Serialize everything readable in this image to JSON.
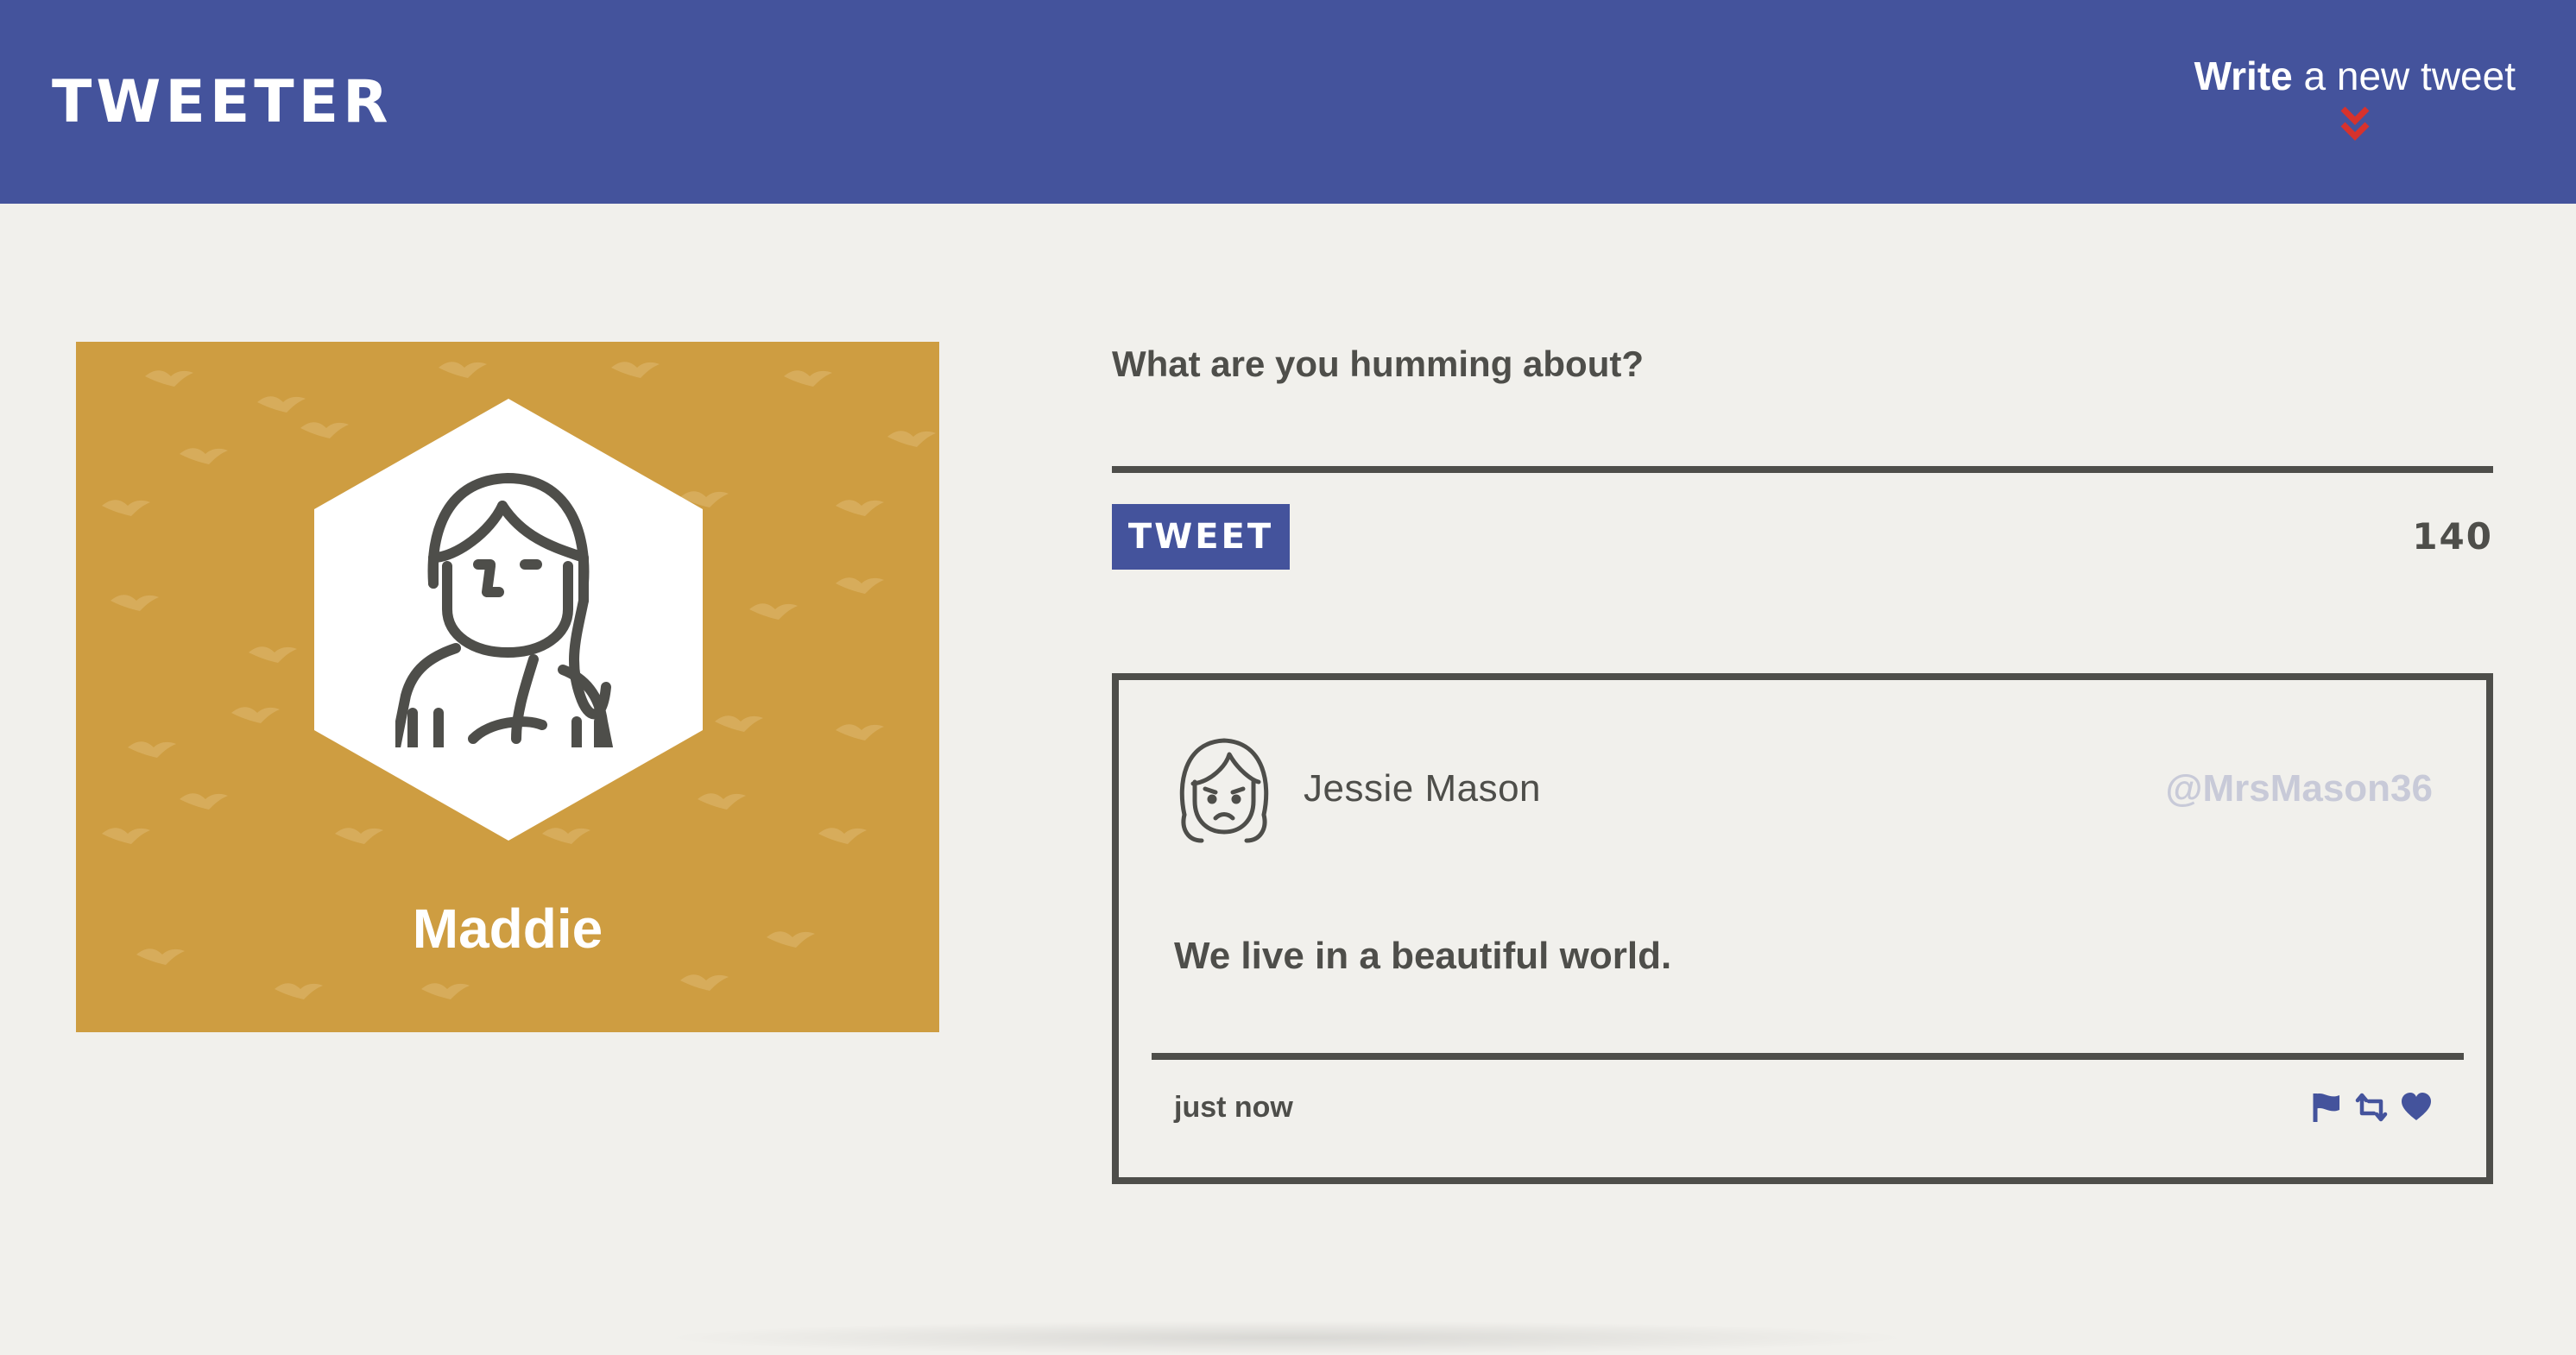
{
  "nav": {
    "brand": "TWEETER",
    "compose_bold": "Write",
    "compose_rest": " a new tweet",
    "compose_icon": "double-chevron-down-icon",
    "compose_icon_color": "#d7322c",
    "background": "#44539c"
  },
  "profile": {
    "name": "Maddie",
    "background": "#ce9d41",
    "avatar_icon": "woman-avatar-icon"
  },
  "new_tweet": {
    "prompt": "What are you humming about?",
    "button_label": "TWEET",
    "counter": "140"
  },
  "tweet": {
    "author_name": "Jessie Mason",
    "handle": "@MrsMason36",
    "content": "We live in a beautiful world.",
    "time": "just now",
    "avatar_icon": "sad-woman-avatar-icon",
    "actions": [
      "flag-icon",
      "retweet-icon",
      "heart-icon"
    ],
    "action_color": "#44539c"
  }
}
